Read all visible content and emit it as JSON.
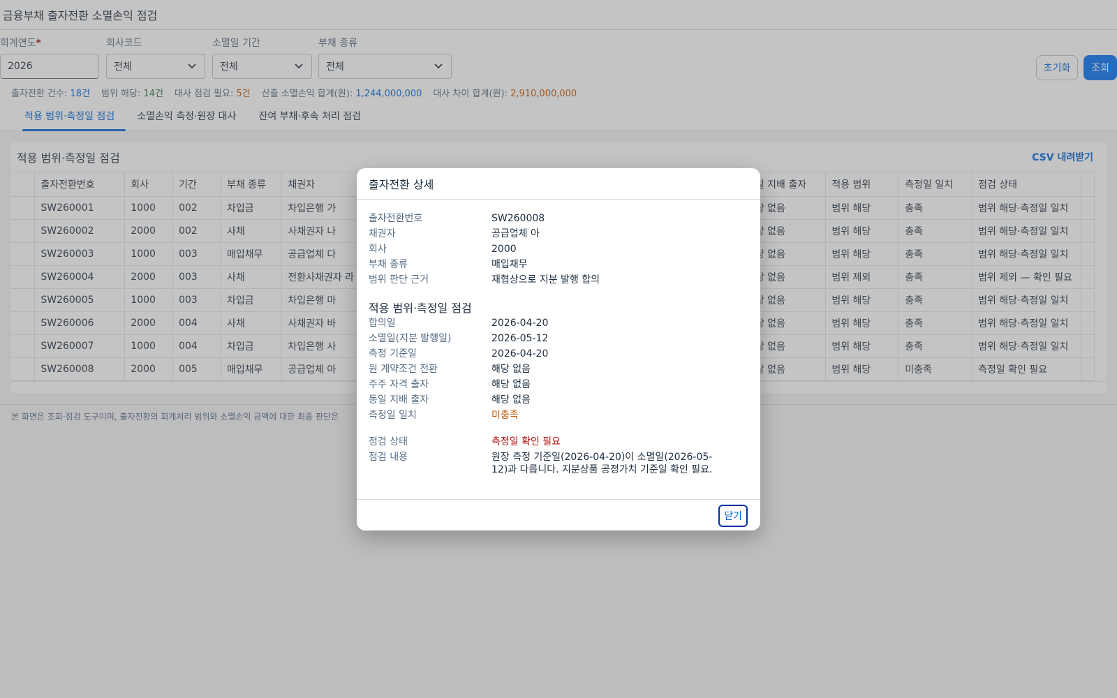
{
  "app": {
    "title": "금융부채 출자전환 소멸손익 점검"
  },
  "filters": [
    {
      "label": "회계연도",
      "required": true,
      "value": "2026",
      "kind": "input"
    },
    {
      "label": "회사코드",
      "value": "전체",
      "kind": "select"
    },
    {
      "label": "소멸일 기간",
      "value": "전체",
      "kind": "select"
    },
    {
      "label": "부채 종류",
      "value": "전체",
      "kind": "select"
    }
  ],
  "actions": {
    "reset": "초기화",
    "search": "조회"
  },
  "summary": [
    {
      "label": "출자전환 건수:",
      "value": "18건",
      "color": "#0064d9"
    },
    {
      "label": "범위 해당:",
      "value": "14건",
      "color": "#256f3a"
    },
    {
      "label": "대사 점검 필요:",
      "value": "5건",
      "color": "#c35500"
    },
    {
      "label": "산출 소멸손익 합계(원):",
      "value": "1,244,000,000",
      "color": "#0064d9"
    },
    {
      "label": "대사 차이 합계(원):",
      "value": "2,910,000,000",
      "color": "#c35500"
    }
  ],
  "tabs": [
    {
      "label": "적용 범위·측정일 점검",
      "active": true
    },
    {
      "label": "소멸손익 측정·원장 대사",
      "active": false
    },
    {
      "label": "잔여 부채·후속 처리 점검",
      "active": false
    }
  ],
  "panel": {
    "title": "적용 범위·측정일 점검",
    "csv": "CSV 내려받기"
  },
  "table": {
    "columns": [
      "출자전환번호",
      "회사",
      "기간",
      "부채 종류",
      "채권자",
      "",
      "",
      "",
      "",
      "",
      "출자",
      "동일 지배 출자",
      "적용 범위",
      "측정일 일치",
      "점검 상태"
    ],
    "rows": [
      {
        "id": "SW260001",
        "company": "1000",
        "period": "002",
        "type": "차입금",
        "creditor": "차입은행 가",
        "same_control": "해당 없음",
        "scope": "범위 해당",
        "scope_status": "ok",
        "date_match": "충족",
        "date_status": "ok",
        "status": "범위 해당·측정일 일치",
        "status_class": "ok"
      },
      {
        "id": "SW260002",
        "company": "2000",
        "period": "002",
        "type": "사채",
        "creditor": "사채권자 나",
        "same_control": "해당 없음",
        "scope": "범위 해당",
        "scope_status": "ok",
        "date_match": "충족",
        "date_status": "ok",
        "status": "범위 해당·측정일 일치",
        "status_class": "ok"
      },
      {
        "id": "SW260003",
        "company": "1000",
        "period": "003",
        "type": "매입채무",
        "creditor": "공급업체 다",
        "same_control": "해당 없음",
        "scope": "범위 해당",
        "scope_status": "ok",
        "date_match": "충족",
        "date_status": "ok",
        "status": "범위 해당·측정일 일치",
        "status_class": "ok"
      },
      {
        "id": "SW260004",
        "company": "2000",
        "period": "003",
        "type": "사채",
        "creditor": "전환사채권자 라",
        "same_control": "해당 없음",
        "scope": "범위 제외",
        "scope_status": "warn",
        "date_match": "충족",
        "date_status": "ok",
        "status": "범위 제외 — 확인 필요",
        "status_class": ""
      },
      {
        "id": "SW260005",
        "company": "1000",
        "period": "003",
        "type": "차입금",
        "creditor": "차입은행 마",
        "same_control": "해당 없음",
        "scope": "범위 해당",
        "scope_status": "ok",
        "date_match": "충족",
        "date_status": "ok",
        "status": "범위 해당·측정일 일치",
        "status_class": "ok"
      },
      {
        "id": "SW260006",
        "company": "2000",
        "period": "004",
        "type": "사채",
        "creditor": "사채권자 바",
        "same_control": "해당 없음",
        "scope": "범위 해당",
        "scope_status": "ok",
        "date_match": "충족",
        "date_status": "ok",
        "status": "범위 해당·측정일 일치",
        "status_class": "ok"
      },
      {
        "id": "SW260007",
        "company": "1000",
        "period": "004",
        "type": "차입금",
        "creditor": "차입은행 사",
        "same_control": "해당 없음",
        "scope": "범위 해당",
        "scope_status": "ok",
        "date_match": "충족",
        "date_status": "ok",
        "status": "범위 해당·측정일 일치",
        "status_class": "ok"
      },
      {
        "id": "SW260008",
        "company": "2000",
        "period": "005",
        "type": "매입채무",
        "creditor": "공급업체 아",
        "same_control": "해당 없음",
        "scope": "범위 해당",
        "scope_status": "ok",
        "date_match": "미충족",
        "date_status": "warn",
        "status": "측정일 확인 필요",
        "status_class": "err"
      }
    ]
  },
  "footer_note": "본 화면은 조회·점검 도구이며, 출자전환의 회계처리 범위와 소멸손익 금액에 대한 최종 판단은",
  "dialog": {
    "title": "출자전환 상세",
    "basic": [
      {
        "k": "출자전환번호",
        "v": "SW260008"
      },
      {
        "k": "채권자",
        "v": "공급업체 아"
      },
      {
        "k": "회사",
        "v": "2000"
      },
      {
        "k": "부채 종류",
        "v": "매입채무"
      },
      {
        "k": "범위 판단 근거",
        "v": "재협상으로 지분 발행 합의"
      }
    ],
    "section_title": "적용 범위·측정일 점검",
    "check": [
      {
        "k": "합의일",
        "v": "2026-04-20"
      },
      {
        "k": "소멸일(지분 발행일)",
        "v": "2026-05-12"
      },
      {
        "k": "측정 기준일",
        "v": "2026-04-20"
      },
      {
        "k": "원 계약조건 전환",
        "v": "해당 없음"
      },
      {
        "k": "주주 자격 출자",
        "v": "해당 없음"
      },
      {
        "k": "동일 지배 출자",
        "v": "해당 없음"
      },
      {
        "k": "측정일 일치",
        "v": "미충족",
        "cls": "warn"
      }
    ],
    "result": [
      {
        "k": "점검 상태",
        "v": "측정일 확인 필요",
        "cls": "err"
      },
      {
        "k": "점검 내용",
        "v": "원장 측정 기준일(2026-04-20)이 소멸일(2026-05-12)과 다릅니다. 지분상품 공정가치 기준일 확인 필요.",
        "cls": "multi"
      }
    ],
    "close": "닫기"
  }
}
